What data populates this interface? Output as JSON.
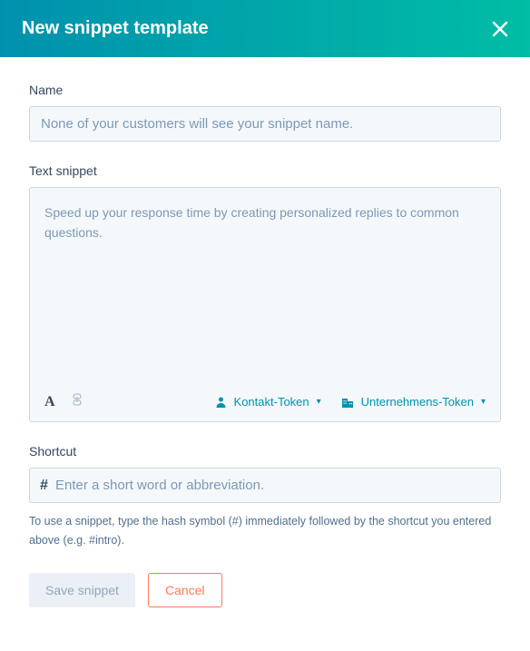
{
  "header": {
    "title": "New snippet template"
  },
  "form": {
    "name": {
      "label": "Name",
      "placeholder": "None of your customers will see your snippet name."
    },
    "snippet": {
      "label": "Text snippet",
      "placeholder": "Speed up your response time by creating personalized replies to common questions."
    },
    "toolbar": {
      "contact_token": "Kontakt-Token",
      "company_token": "Unternehmens-Token"
    },
    "shortcut": {
      "label": "Shortcut",
      "prefix": "#",
      "placeholder": "Enter a short word or abbreviation.",
      "help": "To use a snippet, type the hash symbol (#) immediately followed by the shortcut you entered above (e.g. #intro)."
    }
  },
  "buttons": {
    "save": "Save snippet",
    "cancel": "Cancel"
  }
}
